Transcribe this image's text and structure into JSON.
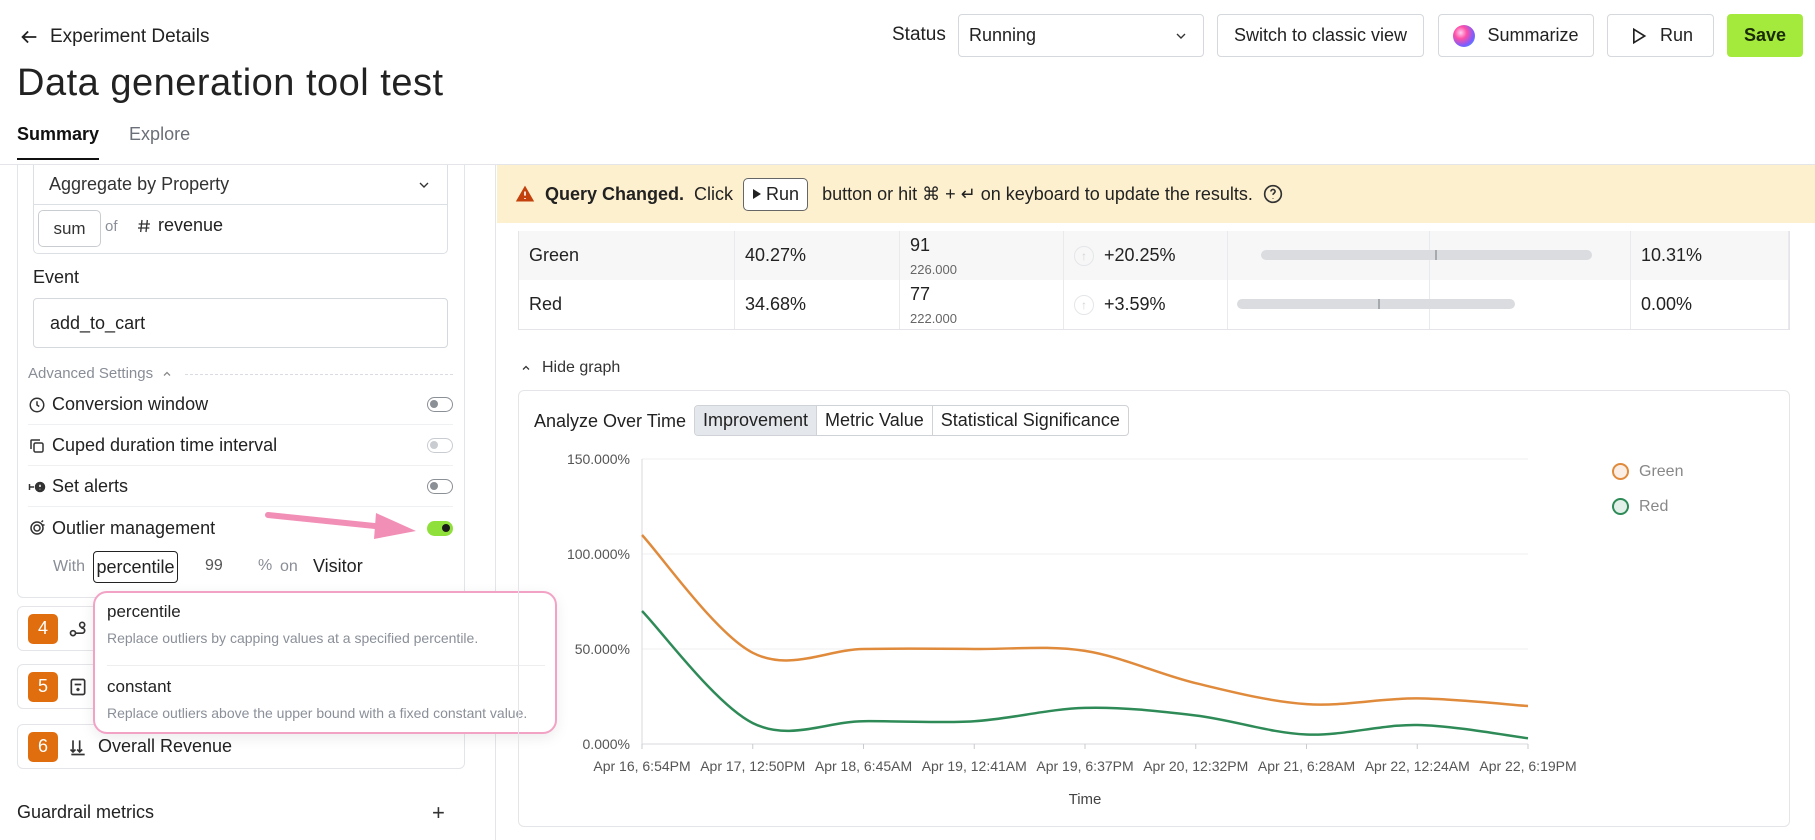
{
  "header": {
    "back_label": "Experiment Details",
    "title": "Data generation tool test",
    "tabs": [
      {
        "label": "Summary"
      },
      {
        "label": "Explore"
      }
    ],
    "status_label": "Status",
    "status_value": "Running",
    "classic_label": "Switch to classic view",
    "summarize_label": "Summarize",
    "run_label": "Run",
    "save_label": "Save"
  },
  "metric_config": {
    "aggregate_label": "Aggregate by Property",
    "agg_fn": "sum",
    "of_label": "of",
    "property": "revenue",
    "event_label": "Event",
    "event_value": "add_to_cart",
    "advanced_label": "Advanced Settings",
    "settings": [
      {
        "label": "Conversion window",
        "state": "off"
      },
      {
        "label": "Cuped duration time interval",
        "state": "disabled"
      },
      {
        "label": "Set alerts",
        "state": "off"
      },
      {
        "label": "Outlier management",
        "state": "on"
      }
    ],
    "outlier": {
      "with_label": "With",
      "method": "percentile",
      "value": "99",
      "percent_sign": "%",
      "on_label": "on",
      "entity": "Visitor"
    }
  },
  "dropdown": {
    "options": [
      {
        "title": "percentile",
        "desc": "Replace outliers by capping values at a specified percentile."
      },
      {
        "title": "constant",
        "desc": "Replace outliers above the upper bound with a fixed constant value."
      }
    ]
  },
  "metrics": [
    {
      "num": "4",
      "label": ""
    },
    {
      "num": "5",
      "label": ""
    },
    {
      "num": "6",
      "label": "Overall Revenue"
    }
  ],
  "guardrail_label": "Guardrail metrics",
  "guardrail_add": "+",
  "banner": {
    "title": "Query Changed.",
    "pre": "Click",
    "run": "Run",
    "post": "button or hit ⌘ + ↵ on keyboard to update the results."
  },
  "table": {
    "rows": [
      {
        "variant": "Green",
        "rate": "40.27%",
        "count": "91",
        "sub": "226.000",
        "uplift": "+20.25%",
        "significance": "10.31%",
        "ci": {
          "low": 0.08,
          "high": 0.9,
          "mid": 0.51
        }
      },
      {
        "variant": "Red",
        "rate": "34.68%",
        "count": "77",
        "sub": "222.000",
        "uplift": "+3.59%",
        "significance": "0.00%",
        "ci": {
          "low": 0.02,
          "high": 0.71,
          "mid": 0.37
        }
      }
    ]
  },
  "hide_graph_label": "Hide graph",
  "analyze_label": "Analyze Over Time",
  "seg_tabs": [
    {
      "label": "Improvement",
      "active": true
    },
    {
      "label": "Metric Value",
      "active": false
    },
    {
      "label": "Statistical Significance",
      "active": false
    }
  ],
  "colors": {
    "green_series": "#2e8b57",
    "red_series": "#e08a3c",
    "accent": "#a3ea3c",
    "badge": "#e06d0e"
  },
  "chart_data": {
    "type": "line",
    "xlabel": "Time",
    "ylabel": "",
    "x": [
      "Apr 16, 6:54PM",
      "Apr 17, 12:50PM",
      "Apr 18, 6:45AM",
      "Apr 19, 12:41AM",
      "Apr 19, 6:37PM",
      "Apr 20, 12:32PM",
      "Apr 21, 6:28AM",
      "Apr 22, 12:24AM",
      "Apr 22, 6:19PM"
    ],
    "y_ticks": [
      "0.000%",
      "50.000%",
      "100.000%",
      "150.000%"
    ],
    "ylim": [
      0,
      150
    ],
    "series": [
      {
        "name": "Green",
        "color": "#e08a3c",
        "values": [
          110,
          48,
          50,
          50,
          49,
          32,
          21,
          24,
          20
        ]
      },
      {
        "name": "Red",
        "color": "#2e8b57",
        "values": [
          70,
          11,
          12,
          12,
          19,
          15,
          5,
          10,
          3
        ]
      }
    ],
    "legend_position": "top-right",
    "grid": true
  }
}
